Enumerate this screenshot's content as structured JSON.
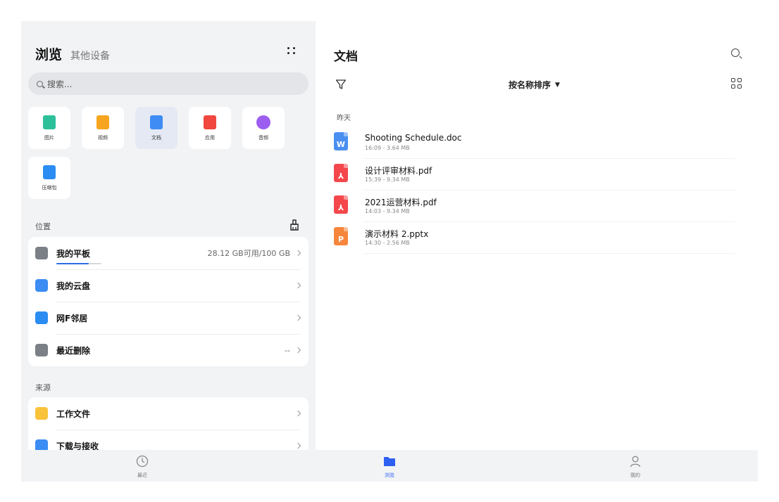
{
  "left": {
    "title": "浏览",
    "subtitle": "其他设备",
    "search_placeholder": "搜索...",
    "categories": [
      {
        "label": "图片",
        "icon": "image-icon",
        "color": "#2cc09a",
        "selected": false
      },
      {
        "label": "视频",
        "icon": "video-icon",
        "color": "#f7a520",
        "selected": false
      },
      {
        "label": "文档",
        "icon": "document-icon",
        "color": "#3f8cf5",
        "selected": true
      },
      {
        "label": "应用",
        "icon": "app-icon",
        "color": "#f1473e",
        "selected": false
      },
      {
        "label": "音频",
        "icon": "audio-icon",
        "color": "#9c5ef0",
        "selected": false
      },
      {
        "label": "压缩包",
        "icon": "archive-icon",
        "color": "#2b8cf2",
        "selected": false
      }
    ],
    "location_label": "位置",
    "locations": [
      {
        "label": "我的平板",
        "info": "28.12 GB可用/100 GB",
        "icon": "tablet-icon",
        "usage_fraction": 0.72
      },
      {
        "label": "我的云盘",
        "info": "",
        "icon": "cloud-icon"
      },
      {
        "label": "网F邻居",
        "info": "",
        "icon": "network-icon"
      },
      {
        "label": "最近删除",
        "info": "--",
        "icon": "trash-icon"
      }
    ],
    "source_label": "来源",
    "sources": [
      {
        "label": "工作文件",
        "icon": "folder-icon"
      },
      {
        "label": "下载与接收",
        "icon": "download-icon"
      }
    ]
  },
  "right": {
    "title": "文档",
    "sort_label": "按名称排序",
    "sort_arrow": "▼",
    "group_label": "昨天",
    "files": [
      {
        "name": "Shooting Schedule.doc",
        "meta": "16:09 - 3.64 MB",
        "type_letter": "W",
        "color": "#4a8ff0"
      },
      {
        "name": "设计评审材料.pdf",
        "meta": "15:39 - 9.34 MB",
        "type_letter": "⅄",
        "color": "#f4474b"
      },
      {
        "name": "2021运营材料.pdf",
        "meta": "14:03 - 9.34 MB",
        "type_letter": "⅄",
        "color": "#f4474b"
      },
      {
        "name": "演示材料 2.pptx",
        "meta": "14:30 - 2.56 MB",
        "type_letter": "P",
        "color": "#f7853b"
      }
    ]
  },
  "nav": {
    "recent": "最近",
    "browse": "浏览",
    "mine": "我的"
  },
  "colors": {
    "accent": "#2d5ff0"
  }
}
